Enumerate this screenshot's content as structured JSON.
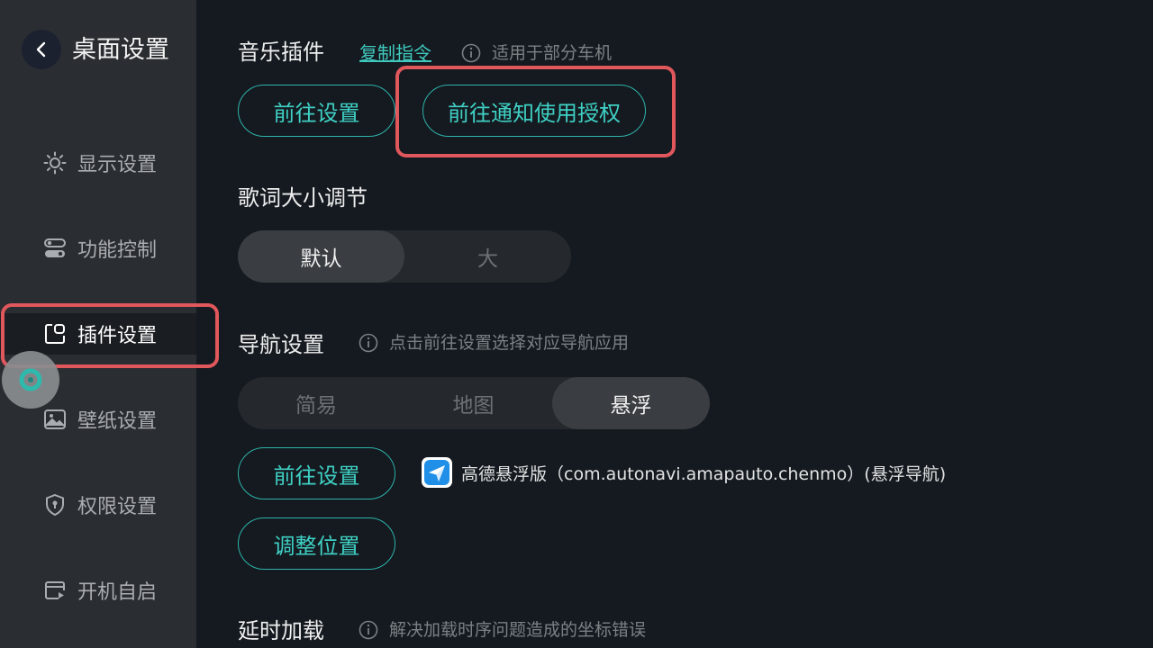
{
  "sidebar": {
    "title": "桌面设置",
    "items": [
      {
        "label": "显示设置",
        "icon": "sun-icon"
      },
      {
        "label": "功能控制",
        "icon": "toggle-icon"
      },
      {
        "label": "插件设置",
        "icon": "plugin-icon",
        "active": true
      },
      {
        "label": "壁纸设置",
        "icon": "image-icon"
      },
      {
        "label": "权限设置",
        "icon": "shield-icon"
      },
      {
        "label": "开机自启",
        "icon": "boot-icon"
      }
    ]
  },
  "music": {
    "title": "音乐插件",
    "copy_link": "复制指令",
    "hint": "适用于部分车机",
    "goto_settings": "前往设置",
    "goto_notification": "前往通知使用授权"
  },
  "lyrics": {
    "title": "歌词大小调节",
    "options": [
      "默认",
      "大"
    ],
    "selected": "默认"
  },
  "navigation": {
    "title": "导航设置",
    "hint": "点击前往设置选择对应导航应用",
    "options": [
      "简易",
      "地图",
      "悬浮"
    ],
    "selected": "悬浮",
    "goto_settings": "前往设置",
    "adjust_position": "调整位置",
    "app_text": "高德悬浮版（com.autonavi.amapauto.chenmo）(悬浮导航)"
  },
  "delay": {
    "title": "延时加载",
    "hint": "解决加载时序问题造成的坐标错误"
  },
  "colors": {
    "accent": "#3fc8bd",
    "highlight": "#e0575c",
    "background": "#141a20",
    "sidebar": "#2a2d31"
  }
}
